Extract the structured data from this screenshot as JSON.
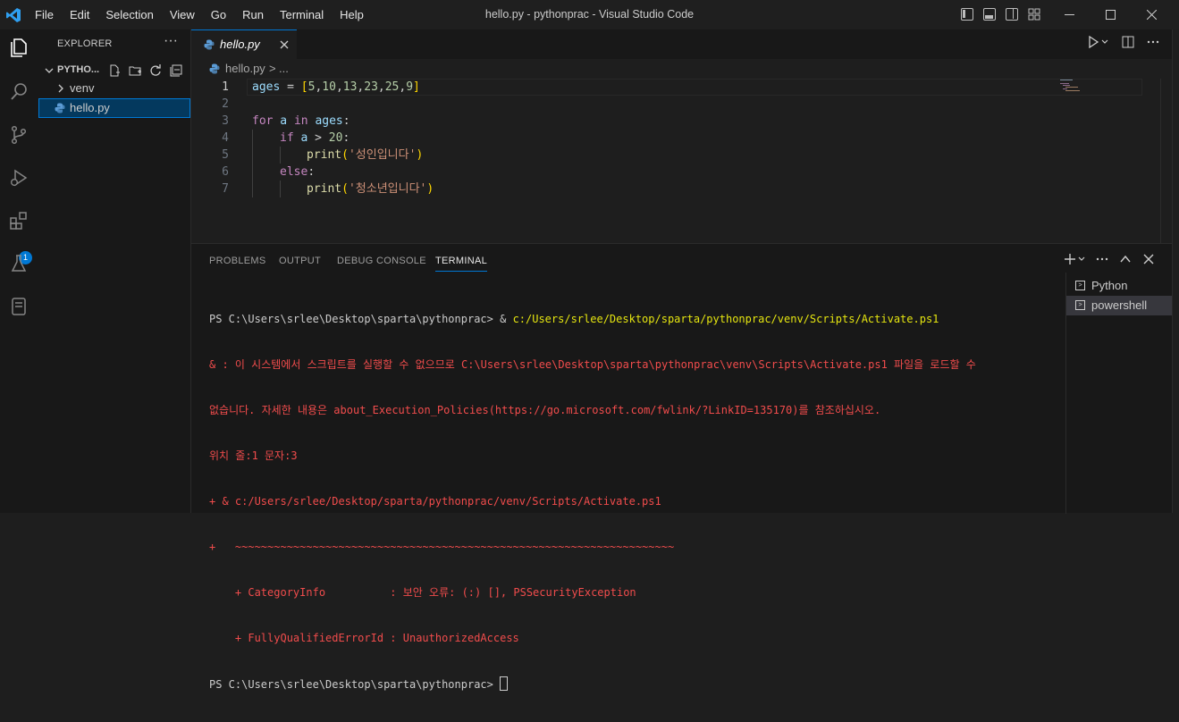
{
  "titlebar": {
    "menu": [
      "File",
      "Edit",
      "Selection",
      "View",
      "Go",
      "Run",
      "Terminal",
      "Help"
    ],
    "window_title": "hello.py - pythonprac - Visual Studio Code",
    "controls": {
      "minimize": "—",
      "maximize": "☐",
      "close": "✕"
    }
  },
  "activity_bar": {
    "icons": [
      "explorer-icon",
      "search-icon",
      "source-control-icon",
      "run-debug-icon",
      "extensions-icon",
      "testing-icon",
      "remote-explorer-icon"
    ],
    "extensions_badge": "1"
  },
  "sidebar": {
    "title": "EXPLORER",
    "more": "···",
    "project": "PYTHO...",
    "items": [
      {
        "label": "venv",
        "type": "folder"
      },
      {
        "label": "hello.py",
        "type": "file"
      }
    ]
  },
  "editor": {
    "tab_label": "hello.py",
    "breadcrumb_file": "hello.py",
    "breadcrumb_sep": ">",
    "breadcrumb_rest": "...",
    "line_numbers": [
      "1",
      "2",
      "3",
      "4",
      "5",
      "6",
      "7"
    ],
    "code": {
      "l1_var": "ages",
      "l1_eq": " = ",
      "l1_open": "[",
      "l1_vals": [
        "5",
        "10",
        "13",
        "23",
        "25",
        "9"
      ],
      "l1_close": "]",
      "l3_for": "for",
      "l3_a": " a ",
      "l3_in": "in",
      "l3_ages": " ages",
      "l3_colon": ":",
      "l4_if": "if",
      "l4_a": " a ",
      "l4_gt": "> ",
      "l4_num": "20",
      "l4_colon": ":",
      "l5_print": "print",
      "l5_str": "'성인입니다'",
      "l6_else": "else",
      "l6_colon": ":",
      "l7_print": "print",
      "l7_str": "'청소년입니다'"
    }
  },
  "panel": {
    "tabs": [
      "PROBLEMS",
      "OUTPUT",
      "DEBUG CONSOLE",
      "TERMINAL"
    ],
    "active_tab": "TERMINAL",
    "terminal_lines": {
      "l1_prompt": "PS C:\\Users\\srlee\\Desktop\\sparta\\pythonprac> & ",
      "l1_path": "c:/Users/srlee/Desktop/sparta/pythonprac/venv/Scripts/Activate.ps1",
      "l2": "& : 이 시스템에서 스크립트를 실행할 수 없으므로 C:\\Users\\srlee\\Desktop\\sparta\\pythonprac\\venv\\Scripts\\Activate.ps1 파일을 로드할 수",
      "l3": "없습니다. 자세한 내용은 about_Execution_Policies(https://go.microsoft.com/fwlink/?LinkID=135170)를 참조하십시오.",
      "l4": "위치 줄:1 문자:3",
      "l5": "+ & c:/Users/srlee/Desktop/sparta/pythonprac/venv/Scripts/Activate.ps1",
      "l6": "+   ~~~~~~~~~~~~~~~~~~~~~~~~~~~~~~~~~~~~~~~~~~~~~~~~~~~~~~~~~~~~~~~~~~~~",
      "l7": "    + CategoryInfo          : 보안 오류: (:) [], PSSecurityException",
      "l8": "    + FullyQualifiedErrorId : UnauthorizedAccess",
      "l9_prompt": "PS C:\\Users\\srlee\\Desktop\\sparta\\pythonprac> "
    },
    "terminals": [
      "Python",
      "powershell"
    ],
    "selected_terminal": "powershell"
  }
}
